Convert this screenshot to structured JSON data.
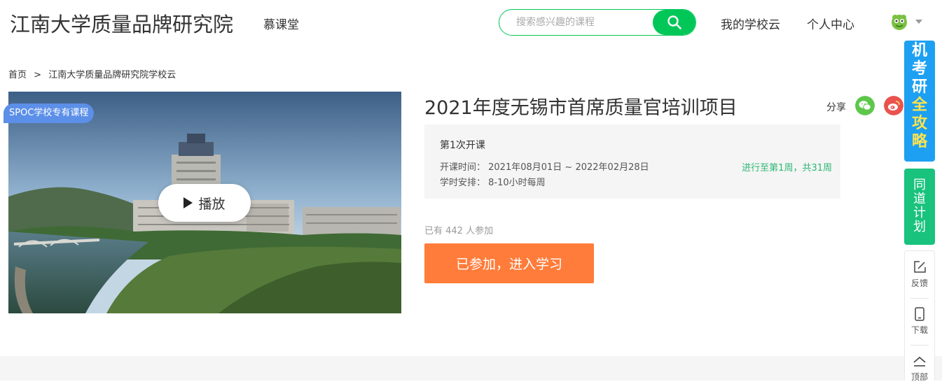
{
  "header": {
    "school_title": "江南大学质量品牌研究院",
    "nav_mooc": "慕课堂",
    "search_placeholder": "搜索感兴趣的课程",
    "my_school_cloud": "我的学校云",
    "personal_center": "个人中心"
  },
  "breadcrumb": {
    "home": "首页",
    "separator": ">",
    "current": "江南大学质量品牌研究院学校云"
  },
  "cover": {
    "badge": "SPOC学校专有课程",
    "play_label": "播放"
  },
  "course": {
    "title": "2021年度无锡市首席质量官培训项目",
    "share_label": "分享",
    "term": "第1次开课",
    "period": "开课时间： 2021年08月01日 ~ 2022年02月28日",
    "hours": "学时安排： 8-10小时每周",
    "progress": "进行至第1周，共31周",
    "enrolled": "已有 442 人参加",
    "enter_button": "已参加，进入学习"
  },
  "sidebar": {
    "banner1_text": [
      "机",
      "考",
      "研"
    ],
    "banner1_highlight": [
      "全",
      "攻",
      "略"
    ],
    "banner2_text": [
      "同",
      "道",
      "计",
      "划"
    ],
    "feedback": "反馈",
    "download": "下载",
    "top": "顶部"
  },
  "colors": {
    "brand_green": "#00c758",
    "enter_orange": "#ff7c3a",
    "badge_blue": "#5b8fe8",
    "progress_green": "#2bb673"
  }
}
